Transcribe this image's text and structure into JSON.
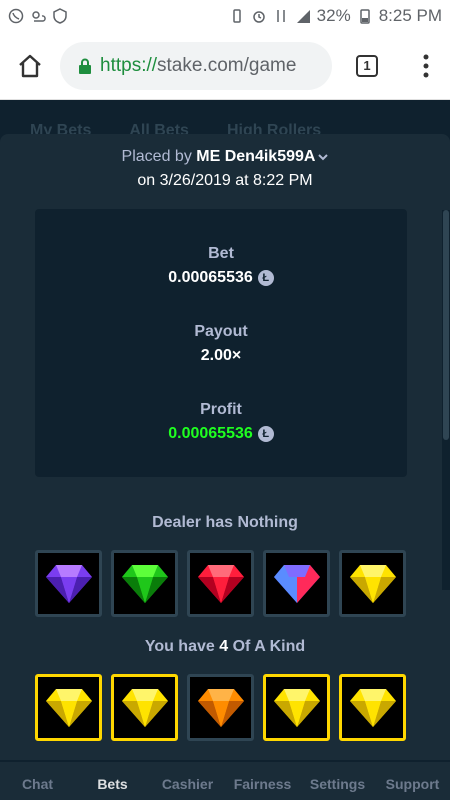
{
  "status_bar": {
    "battery": "32%",
    "time": "8:25 PM"
  },
  "browser": {
    "url_scheme": "https://",
    "url_rest": "stake.com/game",
    "tab_count": "1"
  },
  "background_tabs": [
    "My Bets",
    "All Bets",
    "High Rollers"
  ],
  "bet": {
    "placed_by_prefix": "Placed by",
    "me_tag": "ME",
    "username": "Den4ik599A",
    "date_line": "on 3/26/2019 at 8:22 PM",
    "bet_label": "Bet",
    "bet_value": "0.00065536",
    "payout_label": "Payout",
    "payout_value": "2.00×",
    "profit_label": "Profit",
    "profit_value": "0.00065536",
    "currency_icon": "litecoin-icon",
    "currency_symbol": "Ł",
    "profit_color": "#1fff20"
  },
  "dealer": {
    "title": "Dealer has Nothing",
    "gems": [
      "purple",
      "green",
      "red",
      "blue-red",
      "yellow"
    ]
  },
  "player": {
    "title_prefix": "You have",
    "title_num": "4",
    "title_suffix": "Of A Kind",
    "gems": [
      "yellow",
      "yellow",
      "orange",
      "yellow",
      "yellow"
    ],
    "winning": [
      true,
      true,
      false,
      true,
      true
    ]
  },
  "gem_colors": {
    "purple": [
      "#b77bff",
      "#7a3df0",
      "#4b1fb0"
    ],
    "green": [
      "#5dff3a",
      "#1fc71a",
      "#0a7d0a"
    ],
    "red": [
      "#ff6b7a",
      "#ff1e3c",
      "#b30020"
    ],
    "yellow": [
      "#fff56a",
      "#ffe300",
      "#c9a800"
    ],
    "orange": [
      "#ffb347",
      "#ff8c00",
      "#c25a00"
    ],
    "blue-red": [
      "#5a8cff",
      "#ff2a5a",
      "#3a2fd0"
    ]
  },
  "bottom_nav": [
    "Chat",
    "Bets",
    "Cashier",
    "Fairness",
    "Settings",
    "Support"
  ],
  "active_nav": "Bets"
}
